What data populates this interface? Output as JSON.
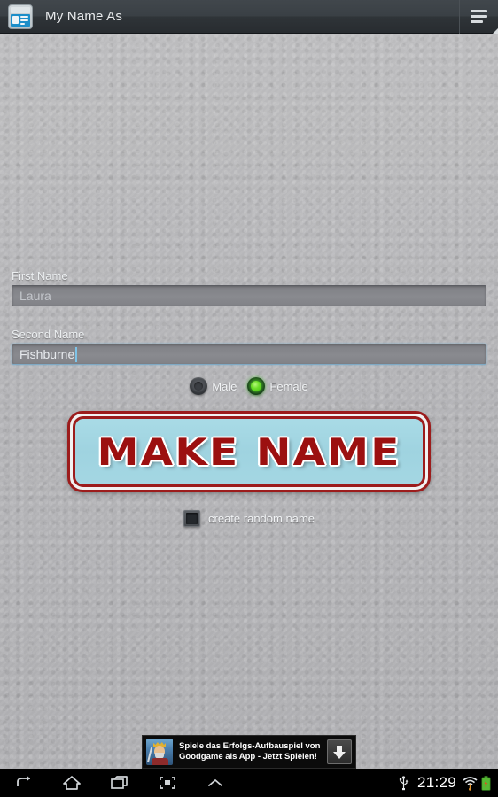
{
  "titlebar": {
    "app_icon_name": "id-card-app-icon",
    "title": "My Name As",
    "menu_icon_name": "overflow-menu-icon"
  },
  "form": {
    "first_name": {
      "label": "First Name",
      "value": "Laura",
      "focused": false
    },
    "second_name": {
      "label": "Second Name",
      "value": "Fishburne",
      "focused": true
    },
    "gender": {
      "options": [
        {
          "label": "Male",
          "selected": false
        },
        {
          "label": "Female",
          "selected": true
        }
      ],
      "selected_value": "Female"
    },
    "make_name_button": {
      "label": "MAKE NAME",
      "text_color": "#9c1010",
      "border_color": "#9c1c1c",
      "fill_color": "#9fd3e0"
    },
    "random_name": {
      "label": "create random name",
      "checked": false
    }
  },
  "ad": {
    "icon_name": "goodgame-king-icon",
    "line1": "Spiele das Erfolgs-Aufbauspiel von",
    "line2": "Goodgame als App - Jetzt Spielen!",
    "cta_icon_name": "download-arrow-icon"
  },
  "navbar": {
    "buttons": [
      {
        "name": "back-icon"
      },
      {
        "name": "home-icon"
      },
      {
        "name": "recents-icon"
      },
      {
        "name": "screenshot-icon"
      },
      {
        "name": "chevron-up-icon"
      }
    ],
    "status": {
      "usb_icon_name": "usb-icon",
      "time": "21:29",
      "wifi_icon_name": "wifi-icon",
      "battery_icon_name": "battery-icon"
    }
  },
  "theme": {
    "titlebar_bg": "#33383c",
    "wallpaper_bg": "#b6b6b9",
    "accent_green": "#6ede2a",
    "accent_red": "#9c1010",
    "button_blue": "#9fd3e0"
  }
}
